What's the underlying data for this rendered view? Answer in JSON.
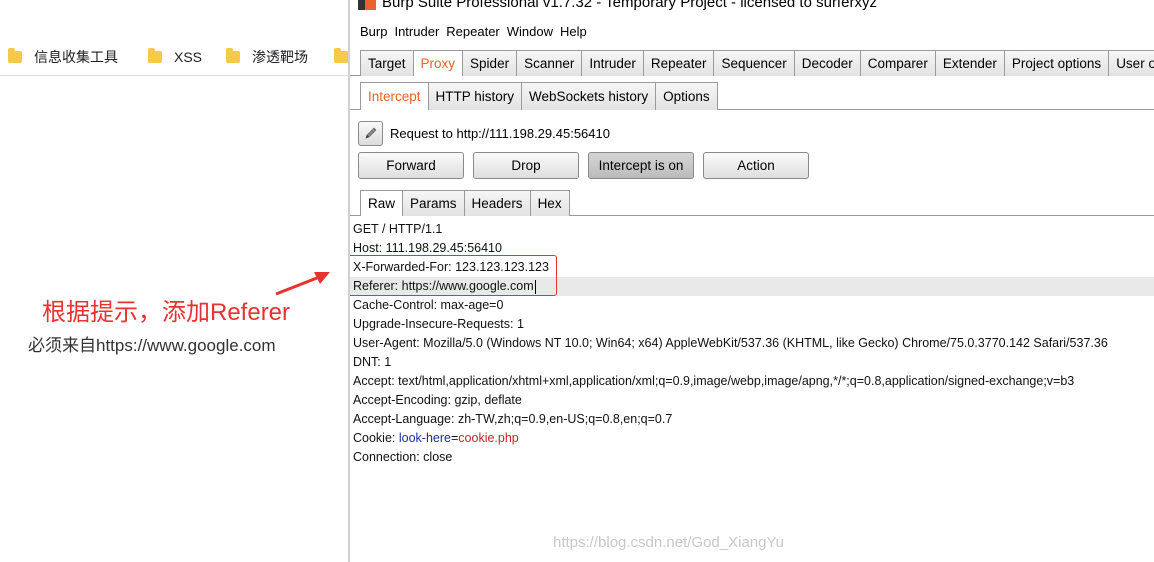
{
  "bookmarks": [
    {
      "label": "信息收集工具"
    },
    {
      "label": "XSS"
    },
    {
      "label": "渗透靶场"
    }
  ],
  "annotation": {
    "title": "根据提示，添加Referer",
    "subtitle": "必须来自https://www.google.com"
  },
  "burp": {
    "window_title": "Burp Suite Professional v1.7.32 - Temporary Project - licensed to surferxyz",
    "menu": [
      "Burp",
      "Intruder",
      "Repeater",
      "Window",
      "Help"
    ],
    "main_tabs": [
      "Target",
      "Proxy",
      "Spider",
      "Scanner",
      "Intruder",
      "Repeater",
      "Sequencer",
      "Decoder",
      "Comparer",
      "Extender",
      "Project options",
      "User options"
    ],
    "sub_tabs": [
      "Intercept",
      "HTTP history",
      "WebSockets history",
      "Options"
    ],
    "request_label": "Request to http://111.198.29.45:56410",
    "buttons": {
      "forward": "Forward",
      "drop": "Drop",
      "intercept": "Intercept is on",
      "action": "Action"
    },
    "view_tabs": [
      "Raw",
      "Params",
      "Headers",
      "Hex"
    ],
    "request_lines": [
      "GET / HTTP/1.1",
      "Host: 111.198.29.45:56410",
      "X-Forwarded-For: 123.123.123.123",
      "Referer: https://www.google.com",
      "Cache-Control: max-age=0",
      "Upgrade-Insecure-Requests: 1",
      "User-Agent: Mozilla/5.0 (Windows NT 10.0; Win64; x64) AppleWebKit/537.36 (KHTML, like Gecko) Chrome/75.0.3770.142 Safari/537.36",
      "DNT: 1",
      "Accept: text/html,application/xhtml+xml,application/xml;q=0.9,image/webp,image/apng,*/*;q=0.8,application/signed-exchange;v=b3",
      "Accept-Encoding: gzip, deflate",
      "Accept-Language: zh-TW,zh;q=0.9,en-US;q=0.8,en;q=0.7"
    ],
    "cookie": {
      "prefix": "Cookie: ",
      "name": "look-here",
      "eq": "=",
      "value": "cookie.php"
    },
    "last_line": "Connection: close",
    "colors": {
      "accent": "#e8622a",
      "annotation": "#e8322f",
      "cookie_name": "#1a2fa0",
      "cookie_value": "#c0262b"
    }
  },
  "watermark": "https://blog.csdn.net/God_XiangYu"
}
